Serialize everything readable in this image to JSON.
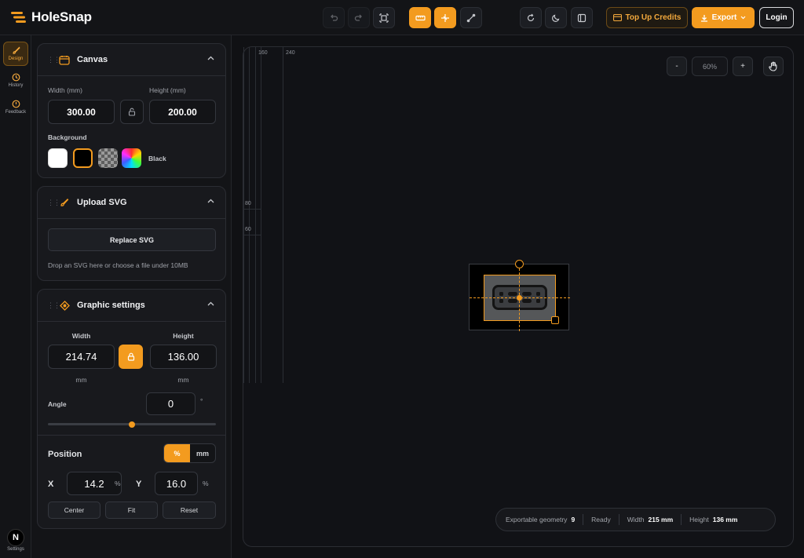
{
  "app": {
    "name": "HoleSnap"
  },
  "header": {
    "credits_label": "Top Up Credits",
    "export_label": "Export",
    "login_label": "Login"
  },
  "rail": {
    "design": "Design",
    "history": "History",
    "feedback": "Feedback",
    "settings": "Settings",
    "settings_avatar": "N"
  },
  "canvas_card": {
    "title": "Canvas",
    "width_label": "Width (mm)",
    "width_value": "300.00",
    "height_label": "Height (mm)",
    "height_value": "200.00",
    "background_label": "Background",
    "background_selected": "Black"
  },
  "upload_card": {
    "title": "Upload SVG",
    "replace_label": "Replace SVG",
    "hint": "Drop an SVG here or choose a file under 10MB"
  },
  "graphic_card": {
    "title": "Graphic settings",
    "width_label": "Width",
    "width_value": "214.74",
    "width_unit": "mm",
    "height_label": "Height",
    "height_value": "136.00",
    "height_unit": "mm",
    "angle_label": "Angle",
    "angle_value": "0",
    "angle_unit": "°",
    "angle_slider_fraction": 0.5,
    "position_label": "Position",
    "unit_percent": "%",
    "unit_mm": "mm",
    "x_label": "X",
    "x_value": "14.2",
    "x_unit": "%",
    "y_label": "Y",
    "y_value": "16.0",
    "y_unit": "%",
    "center_label": "Center",
    "fit_label": "Fit",
    "reset_label": "Reset"
  },
  "canvas": {
    "ruler_labels": {
      "top_a": "160",
      "top_b": "240",
      "left_a": "80",
      "left_b": "60"
    },
    "zoom_out": "-",
    "zoom_level": "60%",
    "zoom_in": "+"
  },
  "status": {
    "geometry_label": "Exportable geometry",
    "geometry_value": "9",
    "state": "Ready",
    "width_label": "Width",
    "width_value": "215 mm",
    "height_label": "Height",
    "height_value": "136 mm"
  },
  "colors": {
    "accent": "#f39b1f",
    "background": "#101114",
    "panel": "#18191d"
  }
}
